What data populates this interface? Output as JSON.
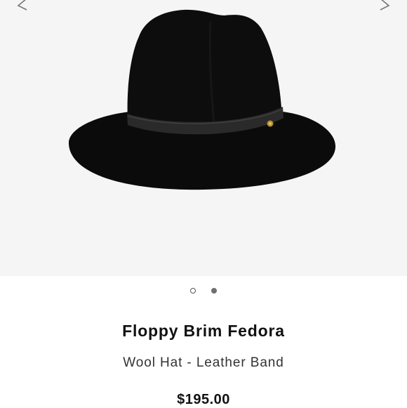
{
  "product": {
    "title": "Floppy Brim Fedora",
    "subtitle": "Wool Hat - Leather Band",
    "price": "$195.00",
    "image": {
      "subject": "black-wool-fedora-with-leather-band-icon"
    }
  },
  "carousel": {
    "prev_icon": "chevron-left-icon",
    "next_icon": "chevron-right-icon",
    "active_index": 1,
    "dot_count": 2
  },
  "colors": {
    "hero_background": "#f5f5f5",
    "hat": "#0b0b0b",
    "band": "#2a2a2a",
    "text": "#111111"
  }
}
